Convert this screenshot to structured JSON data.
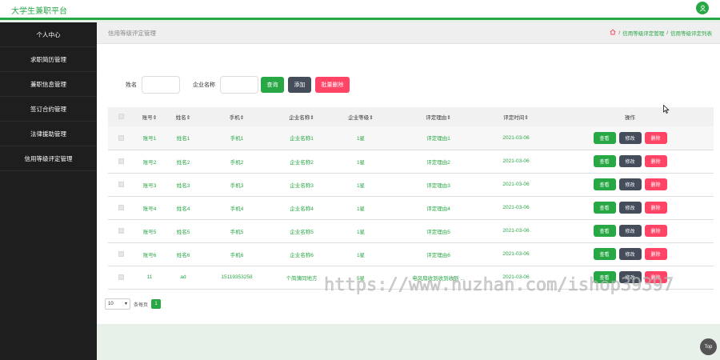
{
  "app": {
    "title": "大学生兼职平台"
  },
  "sidebar": {
    "items": [
      {
        "label": "个人中心"
      },
      {
        "label": "求职简历管理"
      },
      {
        "label": "兼职信息管理"
      },
      {
        "label": "签订合约管理"
      },
      {
        "label": "法律援助管理"
      },
      {
        "label": "信用等级评定管理"
      }
    ]
  },
  "breadcrumb": {
    "page_title": "信用等级评定管理",
    "sep": "/",
    "crumb1": "信用等级评定管理",
    "crumb2": "信用等级评定列表"
  },
  "search": {
    "name_label": "姓名",
    "company_label": "企业名称",
    "search_btn": "查询",
    "add_btn": "添加",
    "batch_delete_btn": "批量删除"
  },
  "table": {
    "headers": [
      "账号⇕",
      "姓名⇕",
      "手机⇕",
      "企业名称⇕",
      "企业等级⇕",
      "评定理由⇕",
      "评定时间⇕",
      "操作"
    ],
    "rows": [
      [
        "账号1",
        "姓名1",
        "手机1",
        "企业名称1",
        "1星",
        "评定理由1",
        "2021-03-06"
      ],
      [
        "账号2",
        "姓名2",
        "手机2",
        "企业名称2",
        "1星",
        "评定理由2",
        "2021-03-06"
      ],
      [
        "账号3",
        "姓名3",
        "手机3",
        "企业名称3",
        "1星",
        "评定理由3",
        "2021-03-06"
      ],
      [
        "账号4",
        "姓名4",
        "手机4",
        "企业名称4",
        "1星",
        "评定理由4",
        "2021-03-06"
      ],
      [
        "账号5",
        "姓名5",
        "手机5",
        "企业名称5",
        "1星",
        "评定理由5",
        "2021-03-06"
      ],
      [
        "账号6",
        "姓名6",
        "手机6",
        "企业名称6",
        "1星",
        "评定理由6",
        "2021-03-06"
      ],
      [
        "11",
        "ad",
        "15119353258",
        "个简薄同地方",
        "5星",
        "电风扇收到收到收到 ...",
        "2021-03-06"
      ]
    ],
    "view_btn": "查看",
    "edit_btn": "修改",
    "delete_btn": "删除"
  },
  "pagination": {
    "page_size": "10",
    "per_page_label": "条每页",
    "current_page": "1"
  },
  "watermark": "https://www.huzhan.com/ishop39397",
  "top_button": "Top",
  "colors": {
    "accent": "#28a745",
    "sidebar_bg": "#1e1e1e",
    "danger": "#ff4466",
    "dark_btn": "#454d5b"
  }
}
